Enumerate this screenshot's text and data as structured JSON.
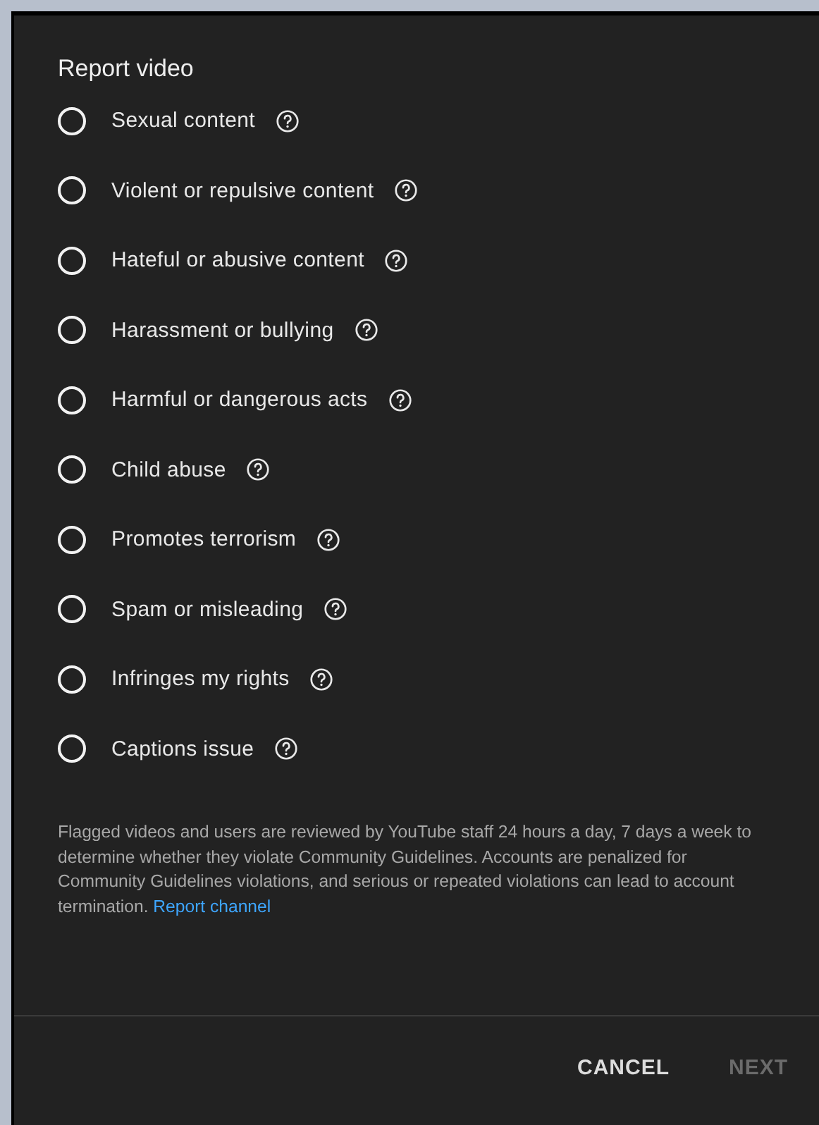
{
  "dialog": {
    "title": "Report video",
    "options": [
      {
        "label": "Sexual content",
        "selected": false
      },
      {
        "label": "Violent or repulsive content",
        "selected": false
      },
      {
        "label": "Hateful or abusive content",
        "selected": false
      },
      {
        "label": "Harassment or bullying",
        "selected": false
      },
      {
        "label": "Harmful or dangerous acts",
        "selected": false
      },
      {
        "label": "Child abuse",
        "selected": false
      },
      {
        "label": "Promotes terrorism",
        "selected": false
      },
      {
        "label": "Spam or misleading",
        "selected": false
      },
      {
        "label": "Infringes my rights",
        "selected": false
      },
      {
        "label": "Captions issue",
        "selected": false
      }
    ],
    "notice": "Flagged videos and users are reviewed by YouTube staff 24 hours a day, 7 days a week to determine whether they violate Community Guidelines. Accounts are penalized for Community Guidelines violations, and serious or repeated violations can lead to account termination.",
    "notice_link": "Report channel",
    "buttons": [
      {
        "label": "CANCEL",
        "disabled": false
      },
      {
        "label": "NEXT",
        "disabled": true
      }
    ]
  }
}
